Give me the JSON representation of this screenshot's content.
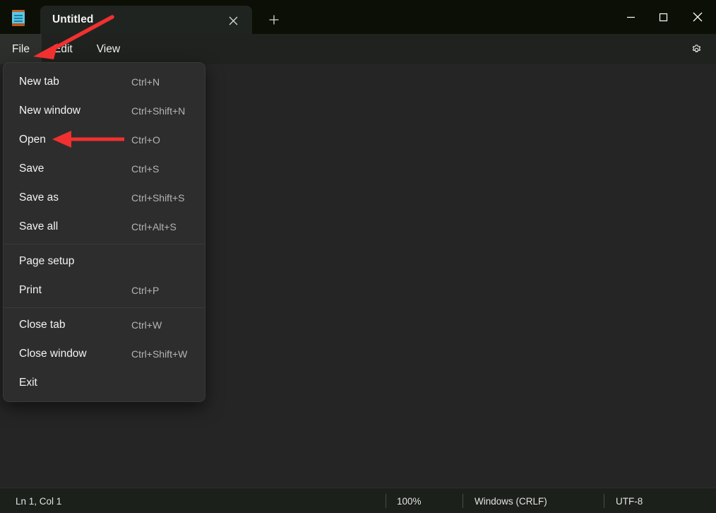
{
  "window": {
    "app_icon": "notepad-icon",
    "minimize_label": "Minimize",
    "maximize_label": "Maximize",
    "close_label": "Close"
  },
  "tabs": {
    "items": [
      {
        "title": "Untitled",
        "close_icon": "close-icon",
        "active": true
      }
    ],
    "new_tab_icon": "plus-icon"
  },
  "menubar": {
    "items": [
      {
        "label": "File",
        "active": true
      },
      {
        "label": "Edit",
        "active": false
      },
      {
        "label": "View",
        "active": false
      }
    ],
    "settings_icon": "gear-icon"
  },
  "file_menu": {
    "groups": [
      {
        "items": [
          {
            "label": "New tab",
            "accel": "Ctrl+N"
          },
          {
            "label": "New window",
            "accel": "Ctrl+Shift+N"
          },
          {
            "label": "Open",
            "accel": "Ctrl+O"
          },
          {
            "label": "Save",
            "accel": "Ctrl+S"
          },
          {
            "label": "Save as",
            "accel": "Ctrl+Shift+S"
          },
          {
            "label": "Save all",
            "accel": "Ctrl+Alt+S"
          }
        ]
      },
      {
        "items": [
          {
            "label": "Page setup",
            "accel": ""
          },
          {
            "label": "Print",
            "accel": "Ctrl+P"
          }
        ]
      },
      {
        "items": [
          {
            "label": "Close tab",
            "accel": "Ctrl+W"
          },
          {
            "label": "Close window",
            "accel": "Ctrl+Shift+W"
          },
          {
            "label": "Exit",
            "accel": ""
          }
        ]
      }
    ]
  },
  "editor": {
    "content": ""
  },
  "statusbar": {
    "position": "Ln 1, Col 1",
    "zoom": "100%",
    "line_ending": "Windows (CRLF)",
    "encoding": "UTF-8"
  },
  "annotations": {
    "color": "#f23030",
    "arrow_file_target": "File",
    "arrow_open_target": "Open"
  },
  "colors": {
    "titlebar_bg": "#0b0f06",
    "menubar_bg": "#1f221e",
    "editor_bg": "#252525",
    "menu_bg": "#2d2d2d",
    "statusbar_bg": "#1c201b",
    "accent_red": "#f23030",
    "icon_blue": "#5bc8e8"
  }
}
